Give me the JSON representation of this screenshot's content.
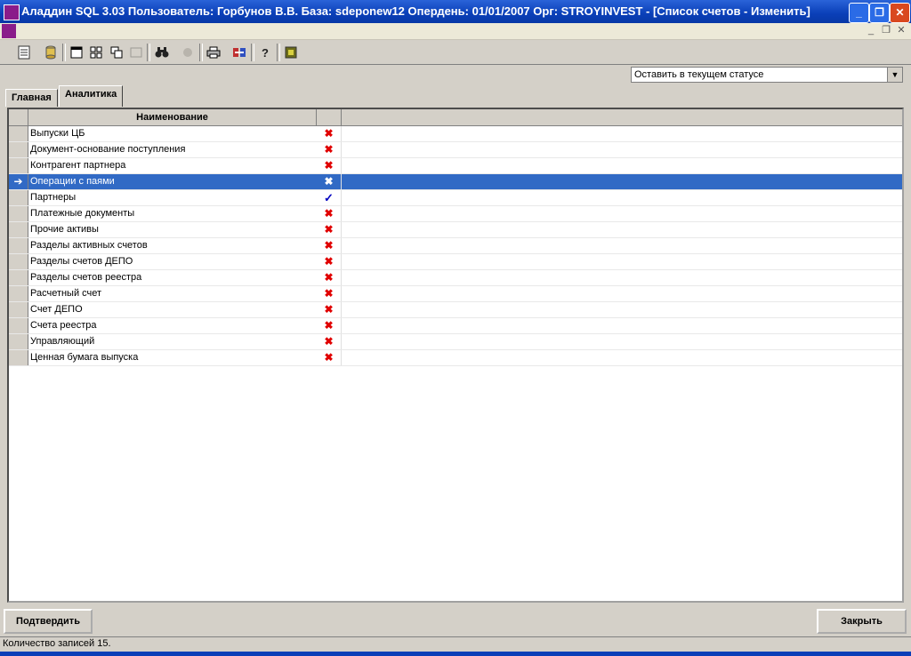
{
  "window": {
    "title": "Аладдин SQL 3.03 Пользователь: Горбунов В.В. База: sdeponew12 Опердень: 01/01/2007 Орг: STROYINVEST - [Список счетов - Изменить]",
    "minimize": "_",
    "maximize": "❐",
    "close": "✕"
  },
  "mdi": {
    "minimize": "_",
    "restore": "❐",
    "close": "✕"
  },
  "toolbar": {
    "icons": [
      "document-icon",
      "database-icon",
      "window-icon",
      "tile-icon",
      "cascade-icon",
      "window-disabled-icon",
      "binoculars-icon",
      "stop-icon",
      "printer-icon",
      "export-icon",
      "help-icon",
      "exit-icon"
    ]
  },
  "status_select": {
    "value": "Оставить в текущем статусе"
  },
  "tabs": [
    {
      "label": "Главная",
      "active": false
    },
    {
      "label": "Аналитика",
      "active": true
    }
  ],
  "grid": {
    "columns": [
      "Наименование",
      ""
    ],
    "rows": [
      {
        "name": "Выпуски ЦБ",
        "mark": "✖",
        "selected": false
      },
      {
        "name": "Документ-основание поступления",
        "mark": "✖",
        "selected": false
      },
      {
        "name": "Контрагент партнера",
        "mark": "✖",
        "selected": false
      },
      {
        "name": "Операции с паями",
        "mark": "✖",
        "selected": true,
        "indicator": "➔"
      },
      {
        "name": "Партнеры",
        "mark": "✓",
        "selected": false
      },
      {
        "name": "Платежные документы",
        "mark": "✖",
        "selected": false
      },
      {
        "name": "Прочие активы",
        "mark": "✖",
        "selected": false
      },
      {
        "name": "Разделы активных счетов",
        "mark": "✖",
        "selected": false
      },
      {
        "name": "Разделы счетов ДЕПО",
        "mark": "✖",
        "selected": false
      },
      {
        "name": "Разделы счетов реестра",
        "mark": "✖",
        "selected": false
      },
      {
        "name": "Расчетный счет",
        "mark": "✖",
        "selected": false
      },
      {
        "name": "Счет ДЕПО",
        "mark": "✖",
        "selected": false
      },
      {
        "name": "Счета реестра",
        "mark": "✖",
        "selected": false
      },
      {
        "name": "Управляющий",
        "mark": "✖",
        "selected": false
      },
      {
        "name": "Ценная бумага выпуска",
        "mark": "✖",
        "selected": false
      }
    ]
  },
  "buttons": {
    "confirm": "Подтвердить",
    "close": "Закрыть"
  },
  "statusbar": {
    "text": "Количество записей 15."
  },
  "colors": {
    "selection": "#316ac5",
    "title_bar": "#0a3fb8",
    "cross": "#e00000",
    "check": "#0000c0"
  }
}
